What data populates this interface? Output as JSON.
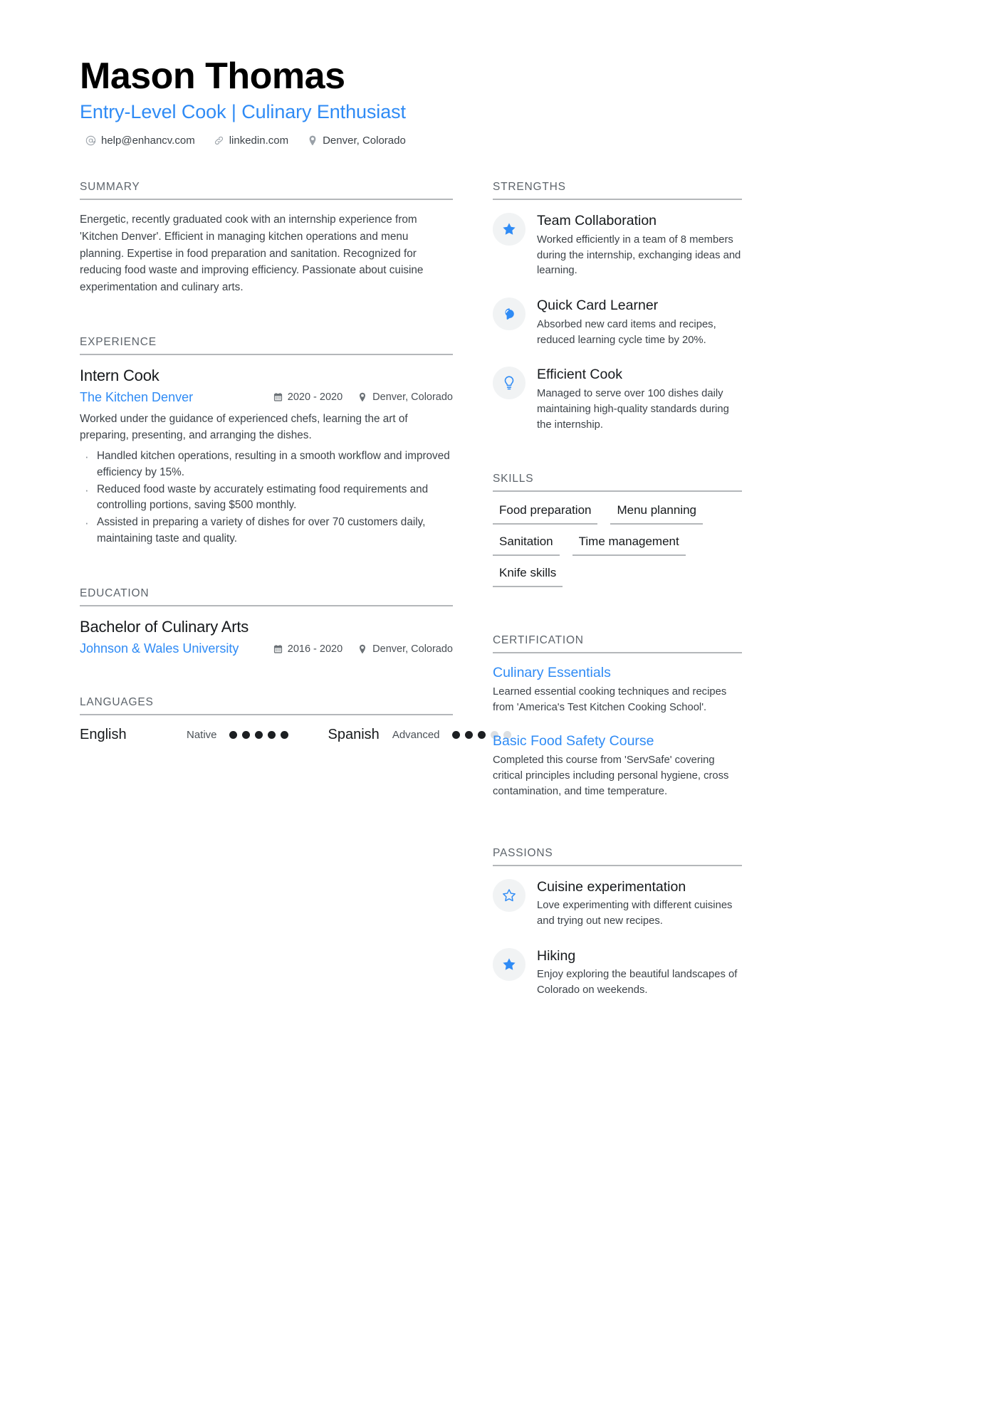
{
  "header": {
    "name": "Mason Thomas",
    "headline": "Entry-Level Cook | Culinary Enthusiast",
    "contacts": [
      {
        "icon": "at-icon",
        "value": "help@enhancv.com"
      },
      {
        "icon": "link-icon",
        "value": "linkedin.com"
      },
      {
        "icon": "location-pin-icon",
        "value": "Denver, Colorado"
      }
    ]
  },
  "left": {
    "summary": {
      "title": "SUMMARY",
      "text": "Energetic, recently graduated cook with an internship experience from 'Kitchen Denver'. Efficient in managing kitchen operations and menu planning. Expertise in food preparation and sanitation. Recognized for reducing food waste and improving efficiency. Passionate about cuisine experimentation and culinary arts."
    },
    "experience": {
      "title": "EXPERIENCE",
      "entries": [
        {
          "role": "Intern Cook",
          "organization": "The Kitchen Denver",
          "dates": "2020 - 2020",
          "location": "Denver, Colorado",
          "description": "Worked under the guidance of experienced chefs, learning the art of preparing, presenting, and arranging the dishes.",
          "bullets": [
            "Handled kitchen operations, resulting in a smooth workflow and improved efficiency by 15%.",
            "Reduced food waste by accurately estimating food requirements and controlling portions, saving $500 monthly.",
            "Assisted in preparing a variety of dishes for over 70 customers daily, maintaining taste and quality."
          ]
        }
      ]
    },
    "education": {
      "title": "EDUCATION",
      "entries": [
        {
          "degree": "Bachelor of Culinary Arts",
          "school": "Johnson & Wales University",
          "dates": "2016 - 2020",
          "location": "Denver, Colorado"
        }
      ]
    },
    "languages": {
      "title": "LANGUAGES",
      "items": [
        {
          "name": "English",
          "level": "Native",
          "filled": 5,
          "total": 5
        },
        {
          "name": "Spanish",
          "level": "Advanced",
          "filled": 3,
          "total": 5
        }
      ]
    }
  },
  "right": {
    "strengths": {
      "title": "STRENGTHS",
      "items": [
        {
          "icon": "star-filled-icon",
          "title": "Team Collaboration",
          "desc": "Worked efficiently in a team of 8 members during the internship, exchanging ideas and learning."
        },
        {
          "icon": "brain-icon",
          "title": "Quick Card Learner",
          "desc": "Absorbed new card items and recipes, reduced learning cycle time by 20%."
        },
        {
          "icon": "lightbulb-icon",
          "title": "Efficient Cook",
          "desc": "Managed to serve over 100 dishes daily maintaining high-quality standards during the internship."
        }
      ]
    },
    "skills": {
      "title": "SKILLS",
      "items": [
        "Food preparation",
        "Menu planning",
        "Sanitation",
        "Time management",
        "Knife skills"
      ]
    },
    "certification": {
      "title": "CERTIFICATION",
      "items": [
        {
          "name": "Culinary Essentials",
          "desc": "Learned essential cooking techniques and recipes from 'America's Test Kitchen Cooking School'."
        },
        {
          "name": "Basic Food Safety Course",
          "desc": "Completed this course from 'ServSafe' covering critical principles including personal hygiene, cross contamination, and time temperature."
        }
      ]
    },
    "passions": {
      "title": "PASSIONS",
      "items": [
        {
          "icon": "star-outline-icon",
          "title": "Cuisine experimentation",
          "desc": "Love experimenting with different cuisines and trying out new recipes."
        },
        {
          "icon": "star-filled-icon",
          "title": "Hiking",
          "desc": "Enjoy exploring the beautiful landscapes of Colorado on weekends."
        }
      ]
    }
  },
  "colors": {
    "accent": "#2f8bf5",
    "rule": "#b4b7ba",
    "heading": "#5d646b",
    "body": "#3c4248"
  }
}
